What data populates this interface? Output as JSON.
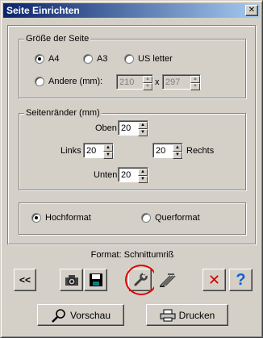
{
  "window": {
    "title": "Seite Einrichten",
    "close_glyph": "✕"
  },
  "page_size": {
    "label": "Größe der Seite",
    "options": [
      {
        "label": "A4",
        "checked": true
      },
      {
        "label": "A3",
        "checked": false
      },
      {
        "label": "US letter",
        "checked": false
      },
      {
        "label": "Andere (mm):",
        "checked": false
      }
    ],
    "custom_width": "210",
    "custom_height": "297",
    "times": "x"
  },
  "margins": {
    "label": "Seitenränder (mm)",
    "top_label": "Oben",
    "top_value": "20",
    "left_label": "Links",
    "left_value": "20",
    "right_label": "Rechts",
    "right_value": "20",
    "bottom_label": "Unten",
    "bottom_value": "20"
  },
  "orientation": {
    "options": [
      {
        "label": "Hochformat",
        "checked": true
      },
      {
        "label": "Querformat",
        "checked": false
      }
    ]
  },
  "format_line": "Format:  Schnittumriß",
  "toolbar": {
    "back_label": "<<",
    "help_label": "?",
    "cancel_label": "✕"
  },
  "actions": {
    "preview_label": "Vorschau",
    "print_label": "Drucken"
  },
  "colors": {
    "highlight_ring": "#e00000",
    "cancel_red": "#d00000",
    "help_blue": "#1060d0"
  }
}
